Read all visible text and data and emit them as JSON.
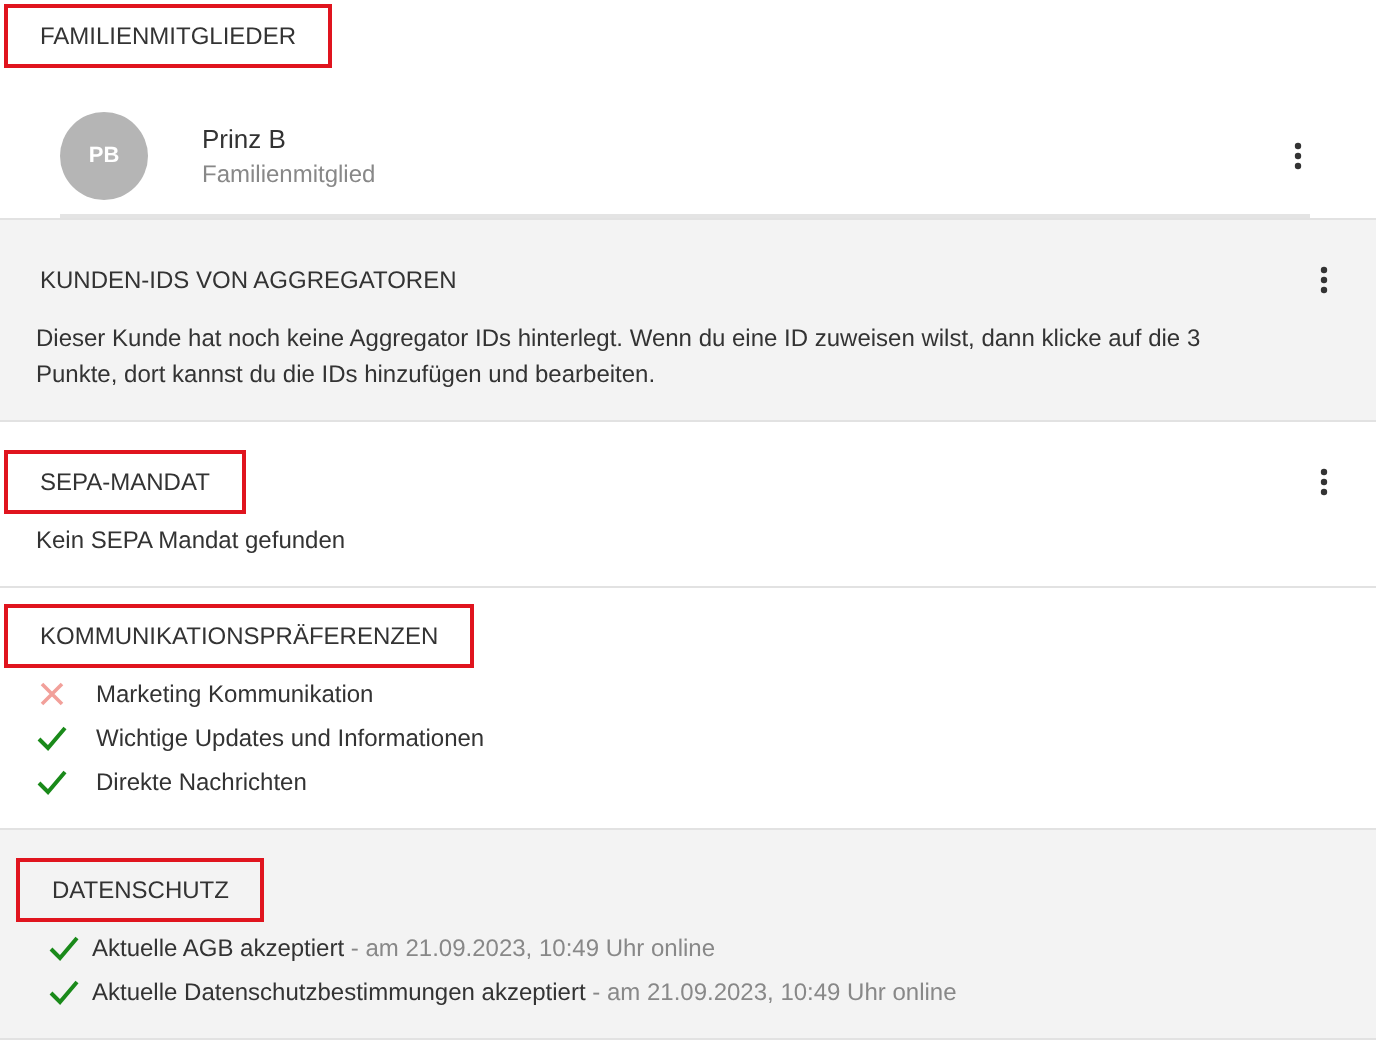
{
  "sections": [
    {
      "kind": "members",
      "title": "FAMILIENMITGLIEDER",
      "highlighted": true,
      "shaded": false,
      "has_menu": false,
      "members": [
        {
          "initials": "PB",
          "name": "Prinz B",
          "role": "Familienmitglied"
        }
      ]
    },
    {
      "kind": "text",
      "title": "KUNDEN-IDS VON AGGREGATOREN",
      "highlighted": false,
      "shaded": true,
      "has_menu": true,
      "text": "Dieser Kunde hat noch keine Aggregator IDs hinterlegt. Wenn du eine ID zuweisen wilst, dann klicke auf die 3 Punkte, dort kannst du die IDs hinzufügen und bearbeiten."
    },
    {
      "kind": "text",
      "title": "SEPA-MANDAT",
      "highlighted": true,
      "shaded": false,
      "has_menu": true,
      "text": "Kein SEPA Mandat gefunden"
    },
    {
      "kind": "checks",
      "title": "KOMMUNIKATIONSPRÄFERENZEN",
      "highlighted": true,
      "shaded": false,
      "has_menu": false,
      "items": [
        {
          "label": "Marketing Kommunikation",
          "checked": false
        },
        {
          "label": "Wichtige Updates und Informationen",
          "checked": true
        },
        {
          "label": "Direkte Nachrichten",
          "checked": true
        }
      ]
    },
    {
      "kind": "consents",
      "title": "DATENSCHUTZ",
      "highlighted": true,
      "shaded": true,
      "has_menu": false,
      "items": [
        {
          "label": "Aktuelle AGB akzeptiert",
          "detail": " - am 21.09.2023, 10:49 Uhr online",
          "checked": true
        },
        {
          "label": "Aktuelle Datenschutzbestimmungen akzeptiert",
          "detail": " - am 21.09.2023, 10:49 Uhr online",
          "checked": true
        }
      ]
    }
  ]
}
